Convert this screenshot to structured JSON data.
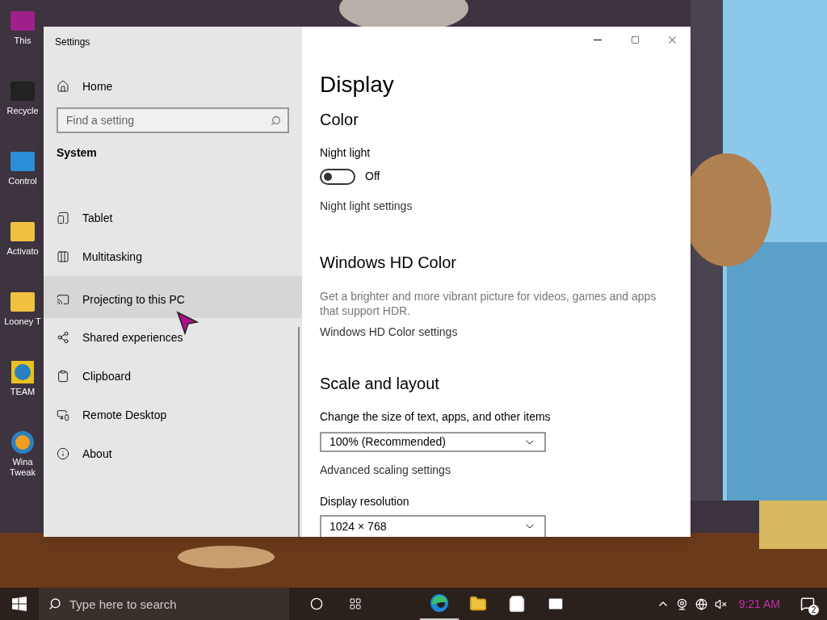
{
  "desktop_icons": [
    {
      "label": "This",
      "kind": "monitor"
    },
    {
      "label": "Recycle",
      "kind": "bin"
    },
    {
      "label": "Control",
      "kind": "panel"
    },
    {
      "label": "Activato",
      "kind": "folder"
    },
    {
      "label": "Looney T",
      "kind": "folder"
    },
    {
      "label": "TEAM",
      "kind": "globe"
    },
    {
      "label": "Wina Tweak",
      "kind": "disc"
    }
  ],
  "window": {
    "title": "Settings"
  },
  "sidebar": {
    "home": "Home",
    "search": {
      "placeholder": "Find a setting"
    },
    "section": "System",
    "items": [
      {
        "label": "Tablet",
        "selected": false
      },
      {
        "label": "Multitasking",
        "selected": false
      },
      {
        "label": "Projecting to this PC",
        "selected": true
      },
      {
        "label": "Shared experiences",
        "selected": false
      },
      {
        "label": "Clipboard",
        "selected": false
      },
      {
        "label": "Remote Desktop",
        "selected": false
      },
      {
        "label": "About",
        "selected": false
      }
    ]
  },
  "page": {
    "title": "Display",
    "color": {
      "heading": "Color",
      "night_light": {
        "label": "Night light",
        "on": false,
        "state": "Off"
      },
      "link": "Night light settings"
    },
    "hd_color": {
      "heading": "Windows HD Color",
      "description": "Get a brighter and more vibrant picture for videos, games and apps that support HDR.",
      "link": "Windows HD Color settings"
    },
    "scale": {
      "heading": "Scale and layout",
      "size_label": "Change the size of text, apps, and other items",
      "size_value": "100% (Recommended)",
      "link": "Advanced scaling settings",
      "resolution_label": "Display resolution",
      "resolution_value": "1024 × 768"
    }
  },
  "taskbar": {
    "search": {
      "placeholder": "Type here to search"
    },
    "time": "9:21 AM",
    "notifications": "2"
  }
}
